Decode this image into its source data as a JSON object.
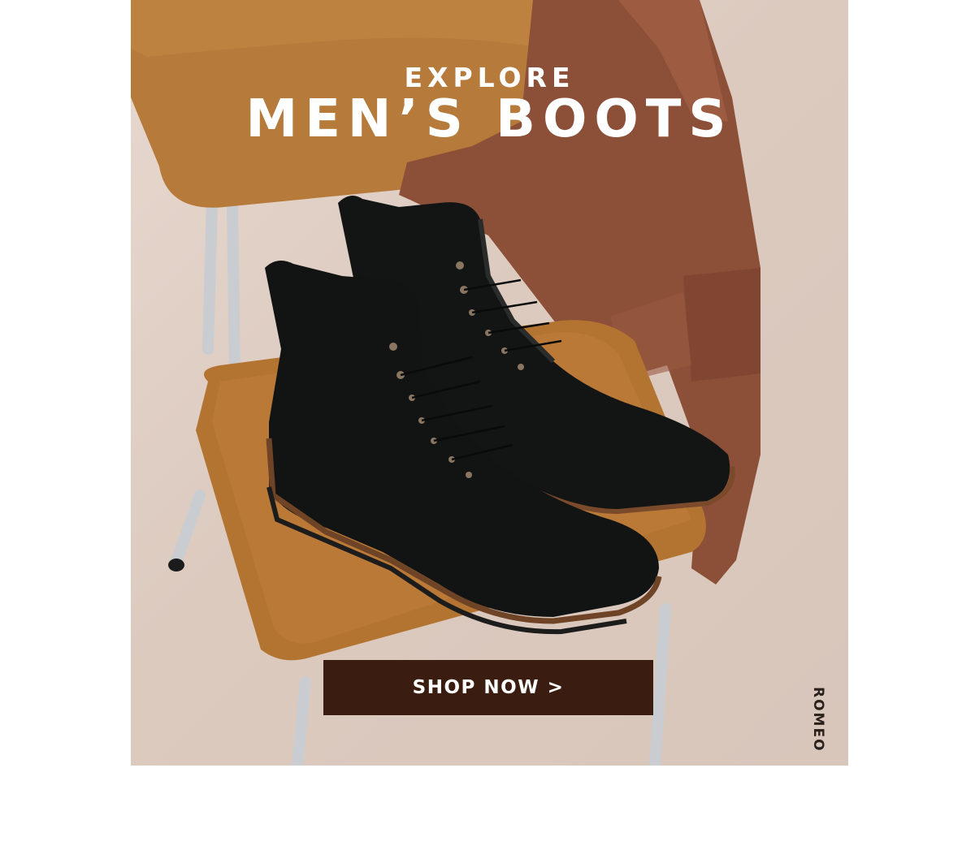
{
  "hero": {
    "eyebrow": "EXPLORE",
    "title": "MEN’S BOOTS",
    "cta_label": "SHOP NOW >",
    "product_credit": "ROMEO"
  },
  "colors": {
    "cta_background": "#3b1c10",
    "headline_text": "#ffffff",
    "chair_leather": "#b57a3a",
    "jacket_leather": "#8c4f38",
    "boot_leather": "#121414"
  }
}
